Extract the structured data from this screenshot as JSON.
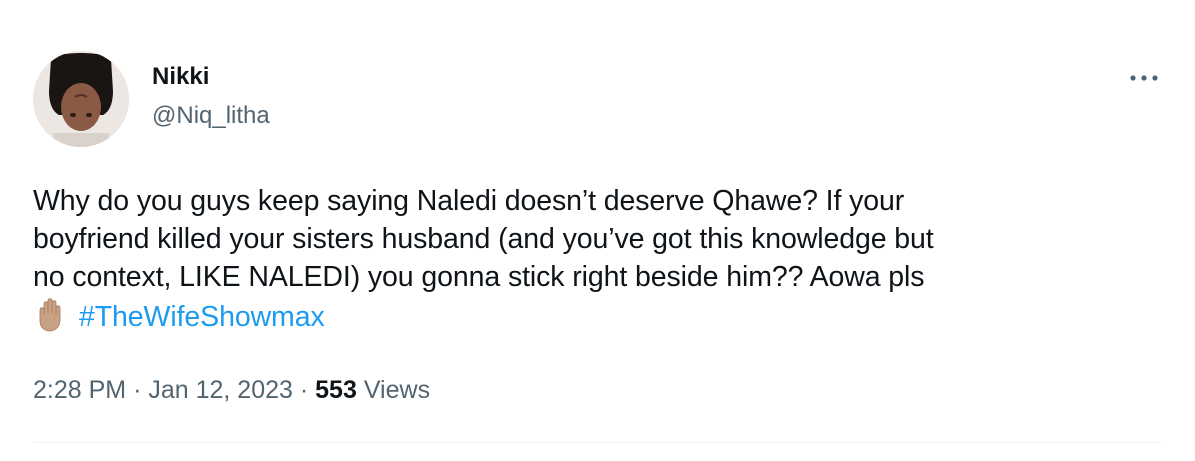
{
  "author": {
    "display_name": "Nikki",
    "handle": "@Niq_litha",
    "avatar_icon": "profile-photo"
  },
  "more_options_icon": "more-horizontal-icon",
  "tweet": {
    "lines": [
      "Why do you guys keep saying Naledi doesn’t deserve Qhawe? If your",
      "boyfriend killed your sisters husband (and you’ve got this knowledge but",
      "no context, LIKE NALEDI) you gonna stick right beside him?? Aowa pls"
    ],
    "emoji": "raised-hand-emoji",
    "hashtag": "#TheWifeShowmax"
  },
  "meta": {
    "time": "2:28 PM",
    "separator": "·",
    "date": "Jan 12, 2023",
    "views_count": "553",
    "views_label": "Views"
  },
  "colors": {
    "text": "#0f1419",
    "secondary": "#536471",
    "link": "#1d9bf0",
    "divider": "#eff3f4"
  }
}
